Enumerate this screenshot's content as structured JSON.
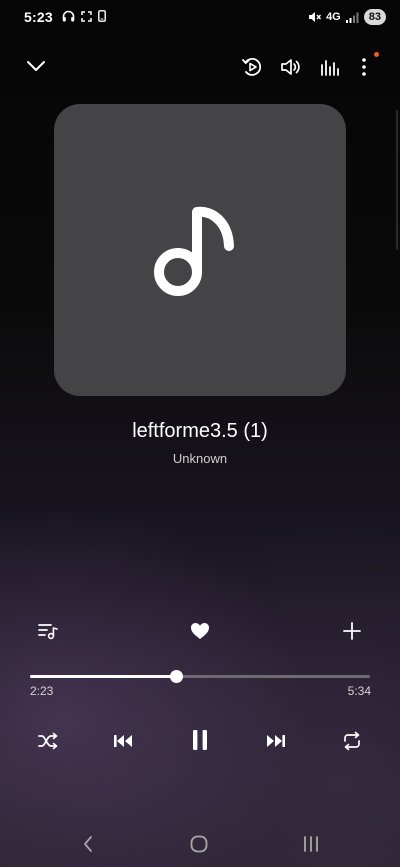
{
  "status_bar": {
    "time": "5:23",
    "network_label": "4G",
    "battery": "83"
  },
  "track": {
    "title": "leftforme3.5 (1)",
    "artist": "Unknown"
  },
  "playback": {
    "elapsed": "2:23",
    "duration": "5:34",
    "progress": 0.428,
    "state": "playing",
    "favorite": true
  },
  "icons": {
    "collapse": "chevron-down-icon",
    "smart_view": "cast-play-icon",
    "volume": "speaker-icon",
    "equalizer": "equalizer-icon",
    "more": "more-vertical-icon",
    "queue": "playlist-icon",
    "favorite": "heart-icon",
    "add": "plus-icon",
    "shuffle": "shuffle-icon",
    "previous": "skip-previous-icon",
    "pause": "pause-icon",
    "next": "skip-next-icon",
    "repeat": "repeat-icon",
    "nav_back": "back-icon",
    "nav_home": "home-icon",
    "nav_recents": "recents-icon"
  },
  "colors": {
    "accent_dot": "#f15a24",
    "album_bg": "#444447"
  }
}
